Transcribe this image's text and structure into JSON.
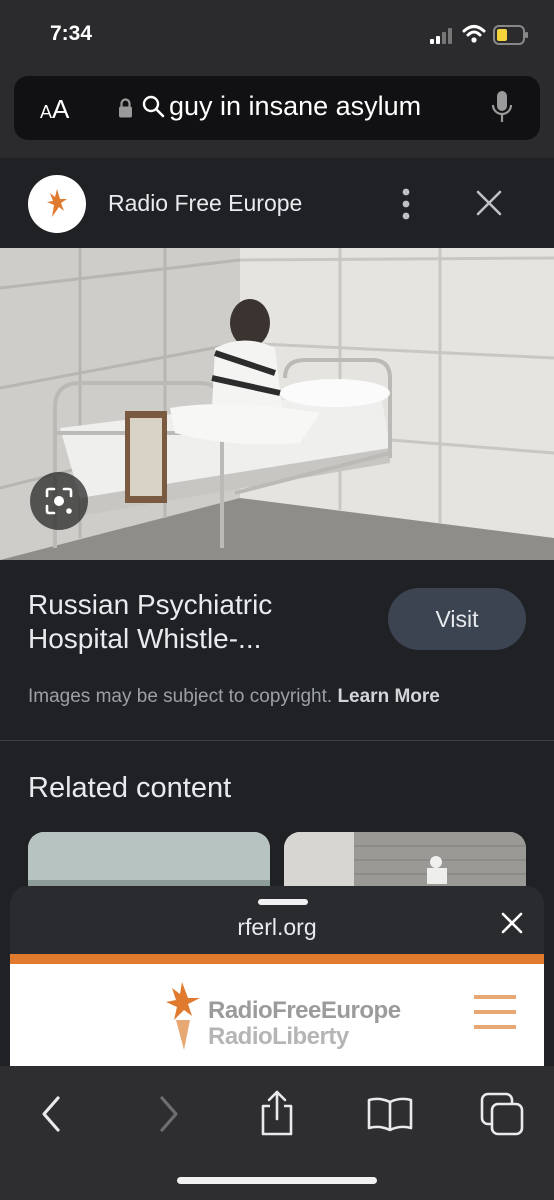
{
  "status_bar": {
    "time": "7:34"
  },
  "address_bar": {
    "reader_label_small": "A",
    "reader_label_large": "A",
    "query": "guy in insane asylum"
  },
  "source": {
    "name": "Radio Free Europe"
  },
  "result": {
    "title": "Russian Psychiatric Hospital Whistle-...",
    "visit_label": "Visit",
    "copyright_text": "Images may be subject to copyright.",
    "learn_more": "Learn More"
  },
  "related": {
    "heading": "Related content"
  },
  "sheet": {
    "domain": "rferl.org",
    "site_logo_line1": "RadioFreeEurope",
    "site_logo_line2": "RadioLiberty"
  },
  "colors": {
    "accent_orange": "#e07a2e",
    "visit_button": "#3c4452",
    "background": "#202124"
  },
  "icons": [
    "signal-icon",
    "wifi-icon",
    "battery-icon",
    "lock-icon",
    "search-icon",
    "microphone-icon",
    "more-vert-icon",
    "close-icon",
    "lens-icon",
    "hamburger-menu-icon",
    "back-icon",
    "forward-icon",
    "share-icon",
    "bookmarks-icon",
    "tabs-icon"
  ]
}
